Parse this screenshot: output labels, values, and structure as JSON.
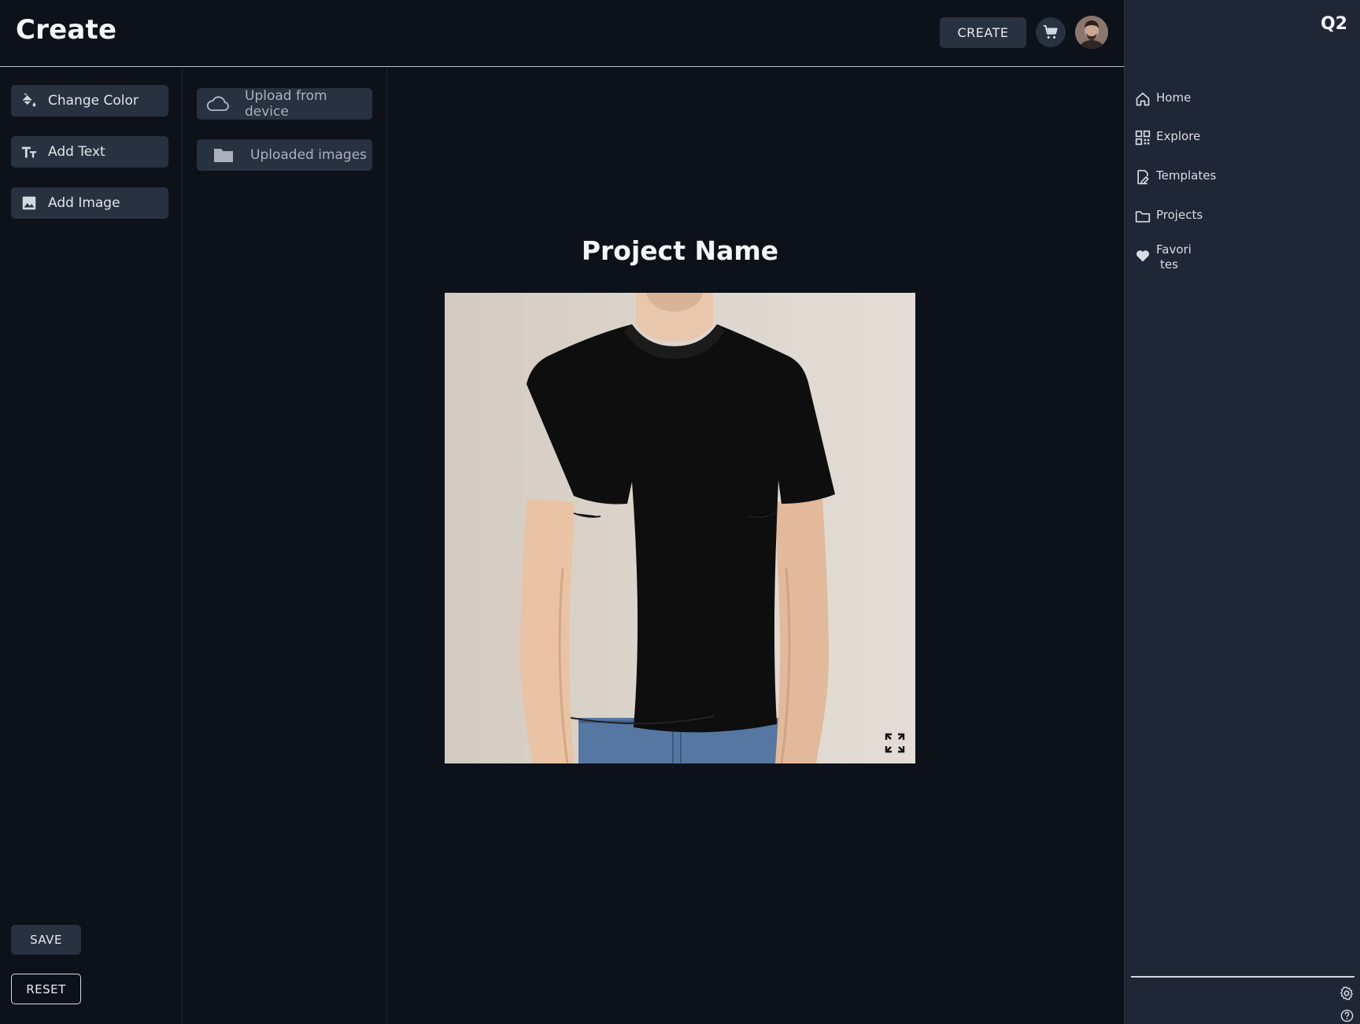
{
  "header": {
    "title": "Create",
    "create_label": "CREATE",
    "cart_icon": "cart-icon",
    "avatar_icon": "user-avatar"
  },
  "tools": {
    "items": [
      {
        "label": "Change Color",
        "icon": "paint-bucket-icon"
      },
      {
        "label": "Add Text",
        "icon": "text-icon"
      },
      {
        "label": "Add Image",
        "icon": "image-icon"
      }
    ],
    "save_label": "SAVE",
    "reset_label": "RESET"
  },
  "upload": {
    "items": [
      {
        "label": "Upload from device",
        "icon": "cloud-upload-icon"
      },
      {
        "label": "Uploaded images",
        "icon": "folder-icon"
      }
    ]
  },
  "canvas": {
    "project_name": "Project Name",
    "expand_icon": "expand-icon"
  },
  "nav": {
    "brand": "Q2",
    "items": [
      {
        "label": "Home",
        "icon": "home-icon"
      },
      {
        "label": "Explore",
        "icon": "grid-icon"
      },
      {
        "label": "Templates",
        "icon": "template-icon"
      },
      {
        "label": "Projects",
        "icon": "folder-icon"
      },
      {
        "label": "Favorites",
        "line1": "Favori",
        "line2": "tes",
        "icon": "heart-icon"
      }
    ],
    "settings_icon": "gear-icon",
    "help_icon": "help-icon"
  },
  "colors": {
    "background": "#0d111a",
    "button": "#283140",
    "nav_background": "#1f2635",
    "text": "#e6e9ef"
  }
}
